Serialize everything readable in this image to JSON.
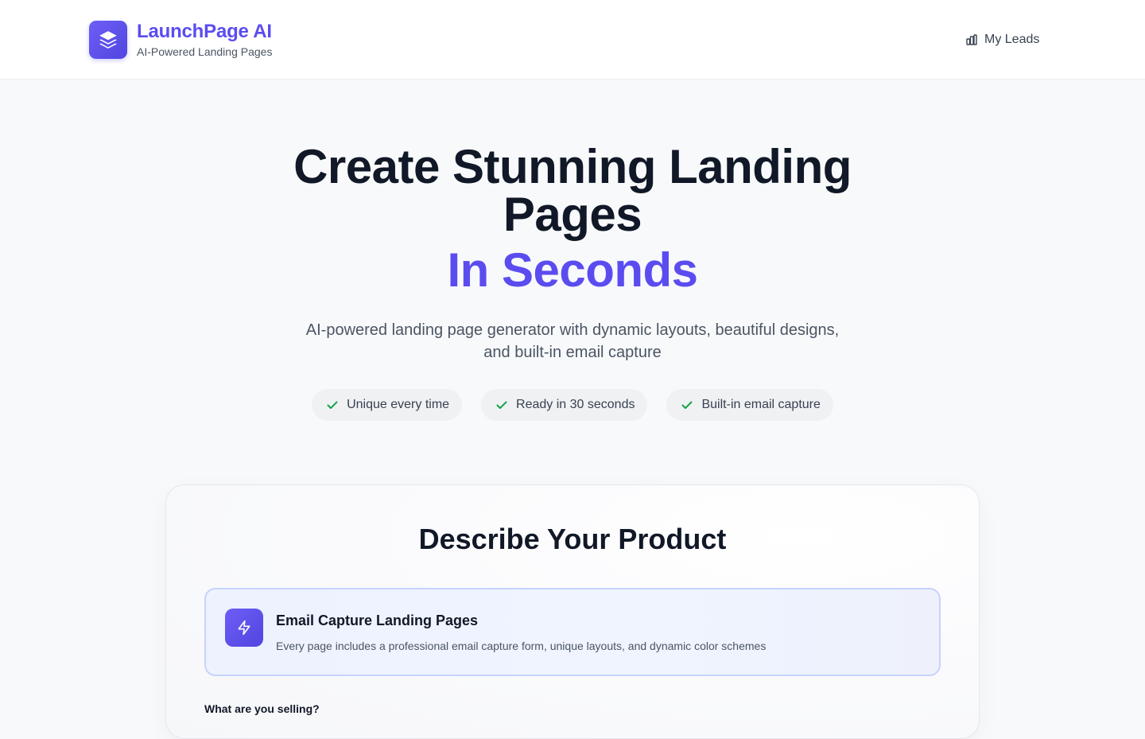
{
  "header": {
    "brand_name": "LaunchPage AI",
    "brand_tagline": "AI-Powered Landing Pages",
    "logo_icon": "layers-icon",
    "nav_leads_label": "My Leads",
    "nav_leads_icon": "bar-chart-icon"
  },
  "hero": {
    "title": "Create Stunning Landing Pages",
    "accent": "In Seconds",
    "subtitle": "AI-powered landing page generator with dynamic layouts, beautiful designs, and built-in email capture",
    "features": [
      {
        "label": "Unique every time",
        "icon": "check-icon"
      },
      {
        "label": "Ready in 30 seconds",
        "icon": "check-icon"
      },
      {
        "label": "Built-in email capture",
        "icon": "check-icon"
      }
    ]
  },
  "form_card": {
    "title": "Describe Your Product",
    "info_title": "Email Capture Landing Pages",
    "info_description": "Every page includes a professional email capture form, unique layouts, and dynamic color schemes",
    "info_icon": "lightning-icon",
    "field_label": "What are you selling?"
  },
  "colors": {
    "brand": "#5b4cf0",
    "heading": "#111827",
    "muted": "#4b5563",
    "check": "#16a34a",
    "info_border": "#c7d2fe",
    "info_bg": "#eef2ff"
  }
}
